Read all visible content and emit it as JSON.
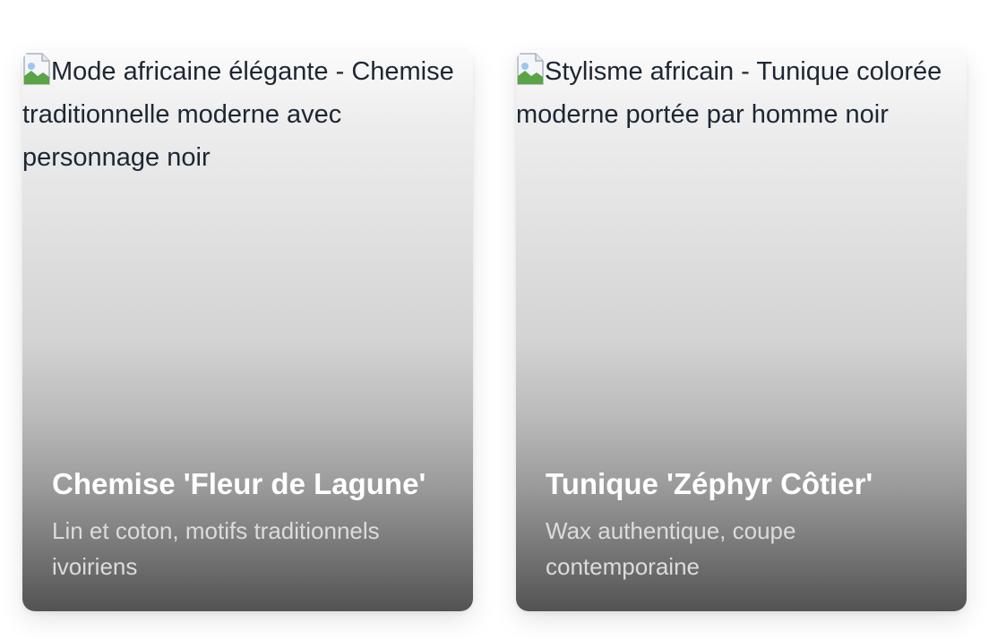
{
  "products": [
    {
      "image_alt": "Mode africaine élégante - Chemise traditionnelle moderne avec personnage noir",
      "title": "Chemise 'Fleur de Lagune'",
      "description": "Lin et coton, motifs traditionnels ivoiriens"
    },
    {
      "image_alt": "Stylisme africain - Tunique colorée moderne portée par homme noir",
      "title": "Tunique 'Zéphyr Côtier'",
      "description": "Wax authentique, coupe contemporaine"
    }
  ],
  "colors": {
    "alt_text": "#1d2733",
    "title": "#ffffff",
    "description": "#dcdcdc"
  },
  "icons": {
    "image_placeholder": "broken-image-icon"
  }
}
